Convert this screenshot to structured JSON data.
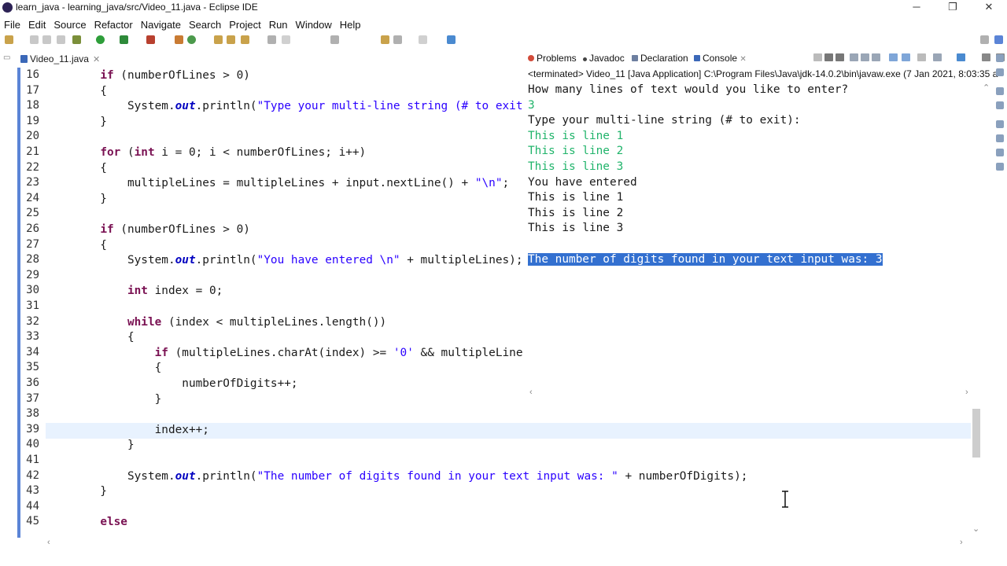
{
  "window": {
    "title": "learn_java - learning_java/src/Video_11.java - Eclipse IDE",
    "controls": [
      "─",
      "❐",
      "✕"
    ]
  },
  "menu": [
    "File",
    "Edit",
    "Source",
    "Refactor",
    "Navigate",
    "Search",
    "Project",
    "Run",
    "Window",
    "Help"
  ],
  "editor": {
    "tab_title": "Video_11.java",
    "tab_close": "✕",
    "line_numbers": [
      "16",
      "17",
      "18",
      "19",
      "20",
      "21",
      "22",
      "23",
      "24",
      "25",
      "26",
      "27",
      "28",
      "29",
      "30",
      "31",
      "32",
      "33",
      "34",
      "35",
      "36",
      "37",
      "38",
      "39",
      "40",
      "41",
      "42",
      "43",
      "44",
      "45"
    ]
  },
  "console": {
    "tabs": [
      "Problems",
      "Javadoc",
      "Declaration",
      "Console"
    ],
    "tab_close": "✕",
    "header": "<terminated> Video_11 [Java Application] C:\\Program Files\\Java\\jdk-14.0.2\\bin\\javaw.exe  (7 Jan 2021, 8:03:35 a",
    "lines": [
      "How many lines of text would you like to enter?",
      "3",
      "Type your multi-line string (# to exit):",
      "This is line 1",
      "This is line 2",
      "This is line 3",
      "You have entered",
      "This is line 1",
      "This is line 2",
      "This is line 3",
      "",
      "The number of digits found in your text input was: 3"
    ]
  },
  "colors": {
    "keyword": "#7a1253",
    "string": "#2a00ff",
    "field": "#0000c0",
    "user_input": "#21b46b",
    "selection": "#3370d0",
    "current_line": "#e8f2fe"
  }
}
